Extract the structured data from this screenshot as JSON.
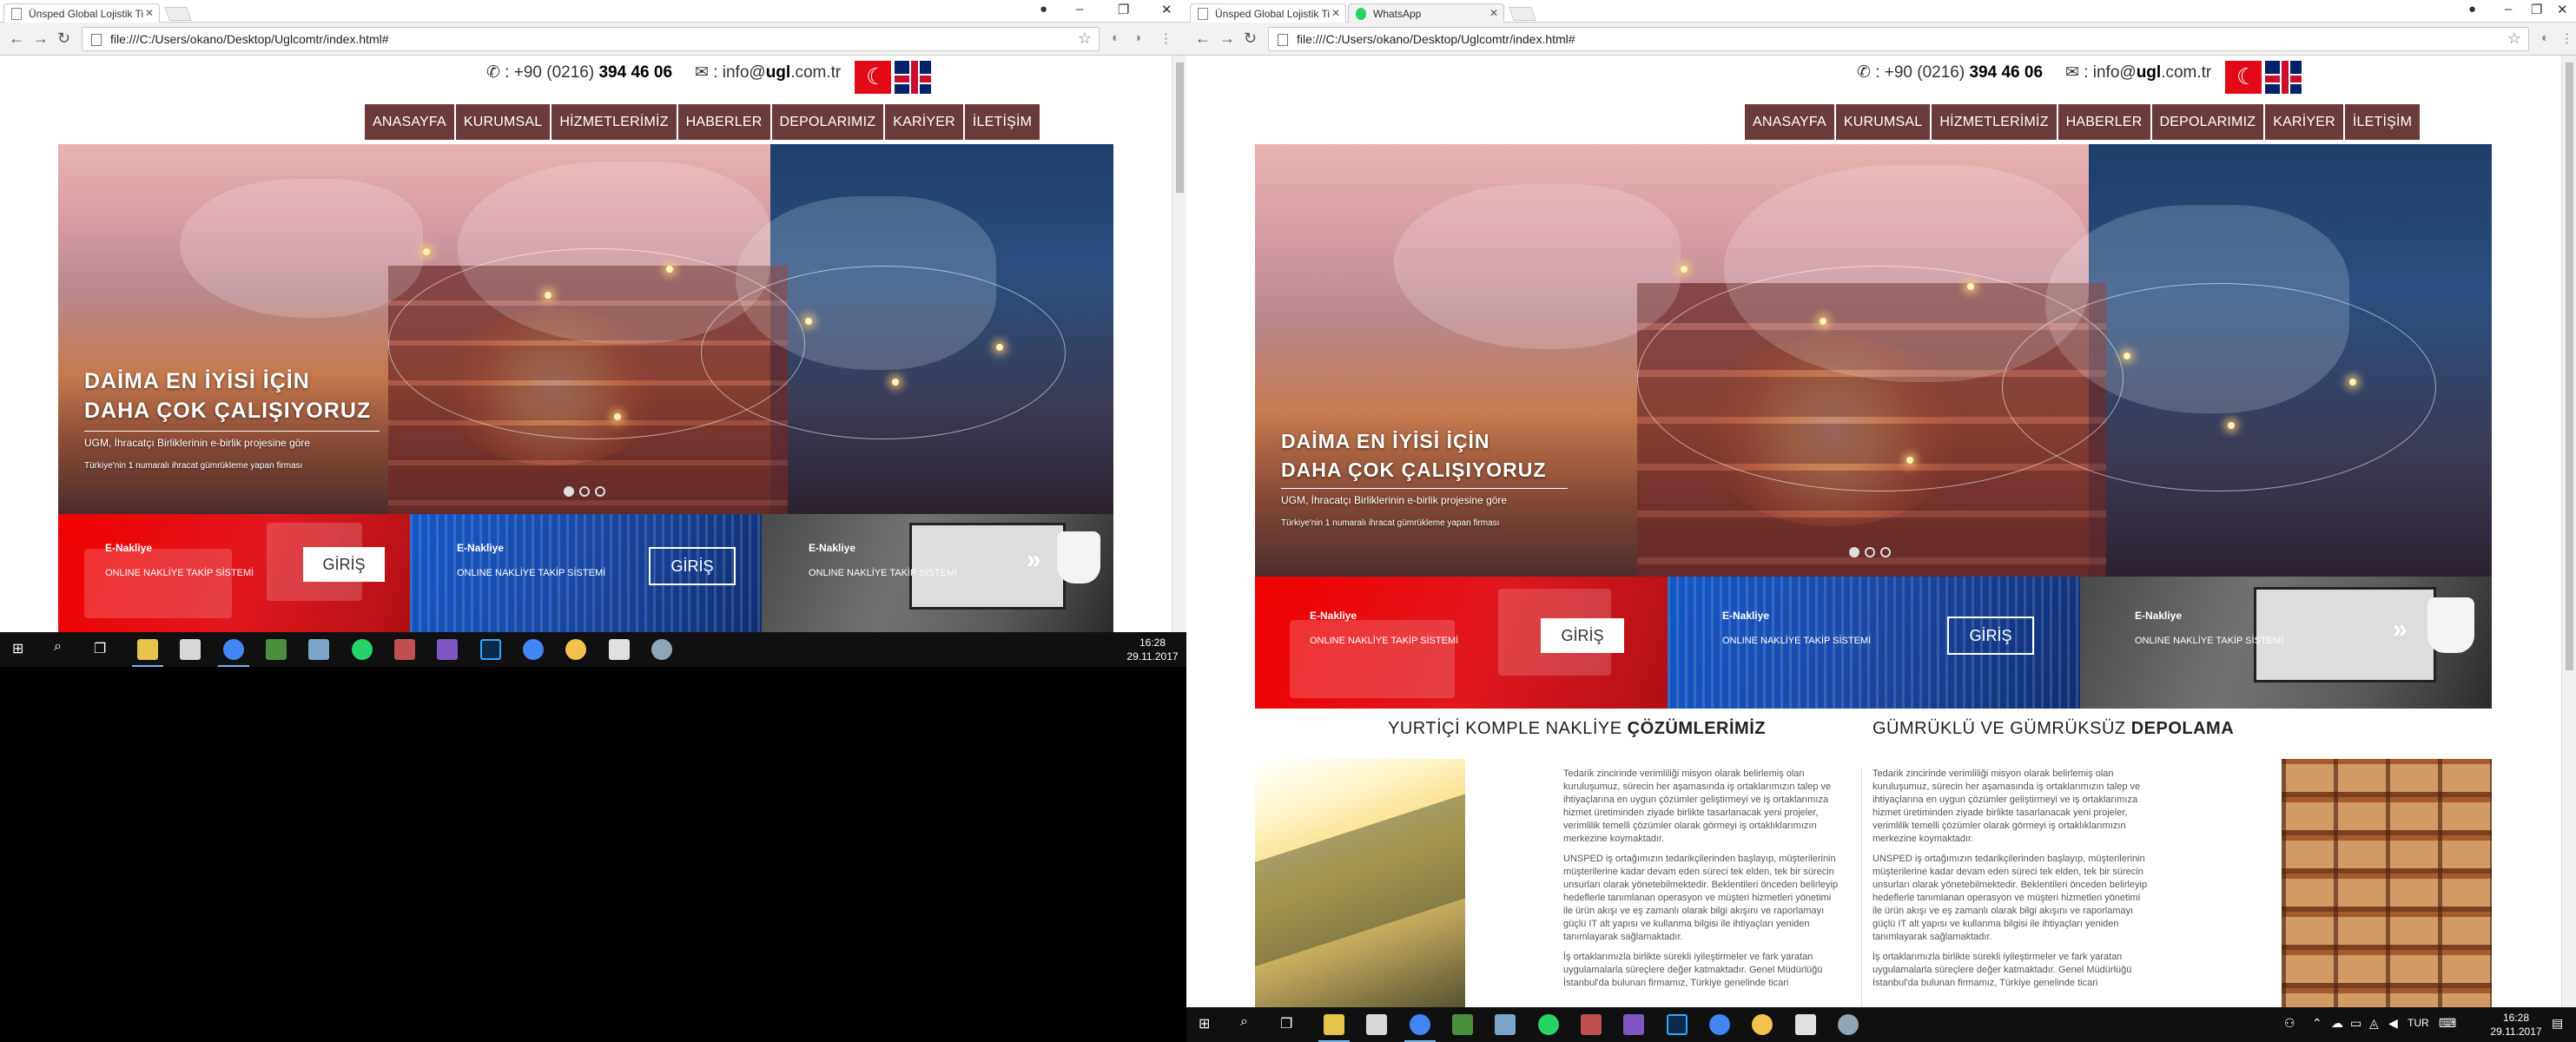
{
  "browser": {
    "tab_title": "Ünsped Global Lojistik Ti",
    "tab2_title": "WhatsApp",
    "url": "file:///C:/Users/okano/Desktop/Uglcomtr/index.html#"
  },
  "site": {
    "phone_prefix": ": +90 (0216) ",
    "phone_bold": "394 46 06",
    "email_prefix": ": info@",
    "email_bold": "ugl",
    "email_suffix": ".com.tr",
    "nav": [
      "ANASAYFA",
      "KURUMSAL",
      "HİZMETLERİMİZ",
      "HABERLER",
      "DEPOLARIMIZ",
      "KARİYER",
      "İLETİŞİM"
    ],
    "hero": {
      "title_line1": "DAİMA EN İYİSİ İÇİN",
      "title_line2": "DAHA ÇOK ÇALIŞIYORUZ",
      "sub1": "UGM, İhracatçı Birliklerinin e-birlik projesine göre",
      "sub2": "Türkiye'nin 1 numaralı ihracat gümrükleme yapan firması",
      "active_slide": 1,
      "slide_count": 3
    },
    "panels": [
      {
        "title": "E-Nakliye",
        "subtitle": "ONLINE NAKLİYE TAKİP SİSTEMİ",
        "button": "GİRİŞ"
      },
      {
        "title": "E-Nakliye",
        "subtitle": "ONLINE NAKLİYE TAKİP SİSTEMİ",
        "button": "GİRİŞ"
      },
      {
        "title": "E-Nakliye",
        "subtitle": "ONLINE NAKLİYE TAKİP SİSTEMİ",
        "button": "»"
      }
    ],
    "sections": {
      "left_title_normal": "YURTİÇİ KOMPLE NAKLİYE ",
      "left_title_bold": "ÇÖZÜMLERİMİZ",
      "right_title_normal": "GÜMRÜKLÜ VE GÜMRÜKSÜZ ",
      "right_title_bold": "DEPOLAMA",
      "p1": "Tedarik zincirinde verimliliği misyon olarak belirlemiş olan kuruluşumuz, sürecin her aşamasında iş ortaklarımızın talep ve ihtiyaçlarına en uygun çözümler geliştirmeyi ve iş ortaklarımıza hizmet üretiminden ziyade birlikte tasarlanacak yeni projeler, verimlilik temelli çözümler olarak görmeyi iş ortaklıklarımızın merkezine koymaktadır.",
      "p2": "UNSPED iş ortağımızın tedarikçilerinden başlayıp, müşterilerinin müşterilerine kadar devam eden süreci tek elden, tek bir sürecin unsurları olarak yönetebilmektedir. Beklentileri önceden belirleyip hedeflerle tanımlanan operasyon ve müşteri hizmetleri yönetimi ile ürün akışı ve eş zamanlı olarak bilgi akışını ve raporlamayı güçlü IT alt yapısı ve kullanma bilgisi ile ihtiyaçları yeniden tanımlayarak sağlamaktadır.",
      "p3": "İş ortaklarımızla birlikte sürekli iyileştirmeler ve fark yaratan uygulamalarla süreçlere değer katmaktadır. Genel Müdürlüğü İstanbul'da bulunan firmamız, Türkiye genelinde ticari"
    }
  },
  "taskbar": {
    "time": "16:28",
    "date": "29.11.2017",
    "lang": "TUR"
  }
}
